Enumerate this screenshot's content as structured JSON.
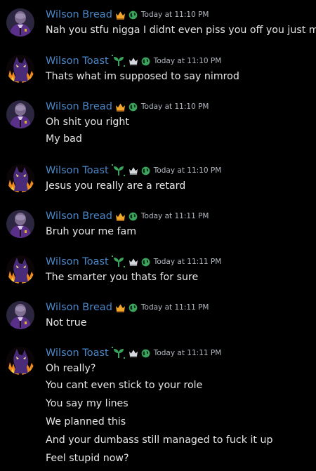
{
  "messages": [
    {
      "author": "Wilson Bread",
      "kind": "bread",
      "badges": [
        "crown-icon",
        "globe-icon"
      ],
      "time": "Today at 11:10 PM",
      "lines": [
        "Nah you stfu nigga I didnt even piss you off you just mad"
      ]
    },
    {
      "author": "Wilson Toast",
      "kind": "toast",
      "badges": [
        "sprout-icon",
        "white-crown-icon",
        "globe-icon"
      ],
      "time": "Today at 11:10 PM",
      "lines": [
        "Thats what im supposed to say nimrod"
      ]
    },
    {
      "author": "Wilson Bread",
      "kind": "bread",
      "badges": [
        "crown-icon",
        "globe-icon"
      ],
      "time": "Today at 11:10 PM",
      "lines": [
        "Oh shit you right",
        "My bad"
      ]
    },
    {
      "author": "Wilson Toast",
      "kind": "toast",
      "badges": [
        "sprout-icon",
        "white-crown-icon",
        "globe-icon"
      ],
      "time": "Today at 11:10 PM",
      "lines": [
        "Jesus you really are a retard"
      ]
    },
    {
      "author": "Wilson Bread",
      "kind": "bread",
      "badges": [
        "crown-icon",
        "globe-icon"
      ],
      "time": "Today at 11:11 PM",
      "lines": [
        "Bruh your me fam"
      ]
    },
    {
      "author": "Wilson Toast",
      "kind": "toast",
      "badges": [
        "sprout-icon",
        "white-crown-icon",
        "globe-icon"
      ],
      "time": "Today at 11:11 PM",
      "lines": [
        "The smarter you thats for sure"
      ]
    },
    {
      "author": "Wilson Bread",
      "kind": "bread",
      "badges": [
        "crown-icon",
        "globe-icon"
      ],
      "time": "Today at 11:11 PM",
      "lines": [
        "Not true"
      ]
    },
    {
      "author": "Wilson Toast",
      "kind": "toast",
      "badges": [
        "sprout-icon",
        "white-crown-icon",
        "globe-icon"
      ],
      "time": "Today at 11:11 PM",
      "lines": [
        "Oh really?",
        "You cant even stick to your role",
        "You say my lines",
        "We planned this",
        "And your dumbass still managed to fuck it up",
        "Feel stupid now?"
      ]
    }
  ],
  "colors": {
    "background": "#000000",
    "username": "#4b86c7",
    "message_text": "#e6e6e6",
    "timestamp": "#b5bac1",
    "crown": "#f0a52b",
    "globe": "#3ba55d",
    "sprout": "#3ba55d"
  }
}
